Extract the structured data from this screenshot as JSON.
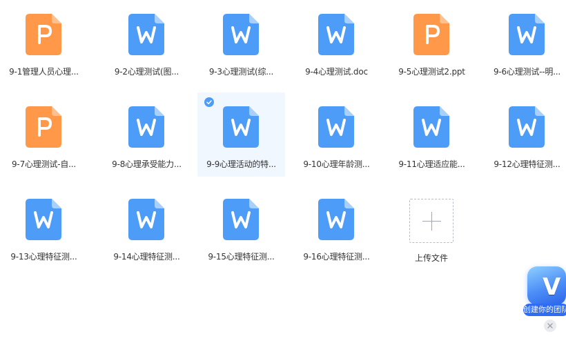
{
  "colors": {
    "word_blue": "#4d9cf7",
    "ppt_orange": "#ff9848",
    "selected_bg": "#f0f7ff",
    "text": "#333333"
  },
  "files": [
    {
      "name": "9-1管理人员心理...",
      "type": "ppt",
      "icon": "ppt-file-icon",
      "letter": "P"
    },
    {
      "name": "9-2心理测试(图...",
      "type": "word",
      "icon": "word-file-icon",
      "letter": "W"
    },
    {
      "name": "9-3心理测试(综...",
      "type": "word",
      "icon": "word-file-icon",
      "letter": "W"
    },
    {
      "name": "9-4心理测试.doc",
      "type": "word",
      "icon": "word-file-icon",
      "letter": "W"
    },
    {
      "name": "9-5心理测试2.ppt",
      "type": "ppt",
      "icon": "ppt-file-icon",
      "letter": "P"
    },
    {
      "name": "9-6心理测试--明...",
      "type": "word",
      "icon": "word-file-icon",
      "letter": "W"
    },
    {
      "name": "9-7心理测试-自...",
      "type": "ppt",
      "icon": "ppt-file-icon",
      "letter": "P"
    },
    {
      "name": "9-8心理承受能力...",
      "type": "word",
      "icon": "word-file-icon",
      "letter": "W"
    },
    {
      "name": "9-9心理活动的特...",
      "type": "word",
      "icon": "word-file-icon",
      "letter": "W",
      "selected": true
    },
    {
      "name": "9-10心理年龄测...",
      "type": "word",
      "icon": "word-file-icon",
      "letter": "W"
    },
    {
      "name": "9-11心理适应能...",
      "type": "word",
      "icon": "word-file-icon",
      "letter": "W"
    },
    {
      "name": "9-12心理特征测...",
      "type": "word",
      "icon": "word-file-icon",
      "letter": "W"
    },
    {
      "name": "9-13心理特征测...",
      "type": "word",
      "icon": "word-file-icon",
      "letter": "W"
    },
    {
      "name": "9-14心理特征测...",
      "type": "word",
      "icon": "word-file-icon",
      "letter": "W"
    },
    {
      "name": "9-15心理特征测...",
      "type": "word",
      "icon": "word-file-icon",
      "letter": "W"
    },
    {
      "name": "9-16心理特征测...",
      "type": "word",
      "icon": "word-file-icon",
      "letter": "W"
    }
  ],
  "upload": {
    "label": "上传文件",
    "icon": "plus-icon"
  },
  "promo": {
    "logo_letter": "V",
    "label": "创建你的团队",
    "icon": "brand-v-icon",
    "close_icon": "close-icon"
  }
}
